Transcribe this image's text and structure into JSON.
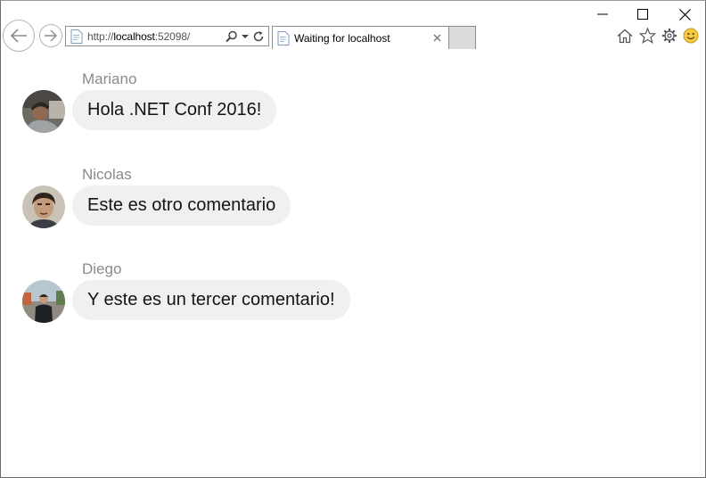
{
  "browser": {
    "address": {
      "scheme": "http://",
      "host": "localhost",
      "rest": ":52098/"
    },
    "tab": {
      "title": "Waiting for localhost"
    },
    "icons": [
      "back-arrow-icon",
      "forward-arrow-icon",
      "page-icon",
      "search-icon",
      "dropdown-icon",
      "refresh-icon",
      "close-icon",
      "minimize-icon",
      "maximize-icon",
      "home-icon",
      "favorites-star-icon",
      "settings-gear-icon",
      "feedback-smiley-icon"
    ]
  },
  "comments": [
    {
      "author": "Mariano",
      "text": "Hola .NET Conf 2016!"
    },
    {
      "author": "Nicolas",
      "text": "Este es otro comentario"
    },
    {
      "author": "Diego",
      "text": "Y este es un tercer comentario!"
    }
  ],
  "colors": {
    "bubble": "#f0f0f0",
    "author": "#8a8a8a",
    "text": "#141414",
    "smiley": "#f7c948"
  }
}
